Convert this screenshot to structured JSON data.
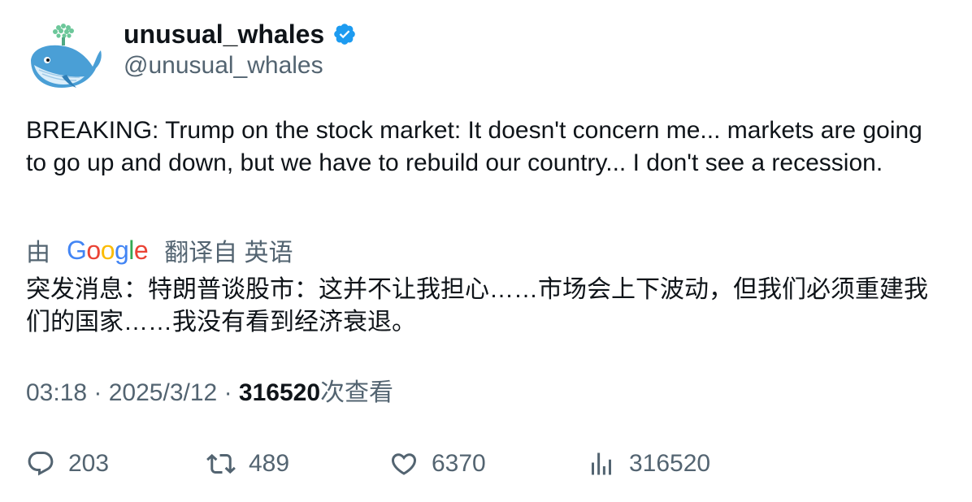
{
  "author": {
    "display_name": "unusual_whales",
    "handle": "@unusual_whales",
    "verified": true,
    "avatar_icon": "whale-logo-icon"
  },
  "tweet": {
    "text": "BREAKING: Trump on the stock market: It doesn't concern me... markets are going to go up and down, but we have to rebuild our country... I don't see a recession."
  },
  "translation": {
    "prefix": "由",
    "provider": "Google",
    "suffix": "翻译自 英语",
    "text": "突发消息：特朗普谈股市：这并不让我担心……市场会上下波动，但我们必须重建我们的国家……我没有看到经济衰退。"
  },
  "meta": {
    "time": "03:18",
    "separator": "·",
    "date": "2025/3/12",
    "views_count": "316520",
    "views_label": "次查看"
  },
  "actions": {
    "replies": "203",
    "retweets": "489",
    "likes": "6370",
    "views": "316520"
  },
  "colors": {
    "text_primary": "#0f1419",
    "text_secondary": "#536471",
    "verified_blue": "#1d9bf0",
    "whale_blue": "#4a9fd6"
  }
}
